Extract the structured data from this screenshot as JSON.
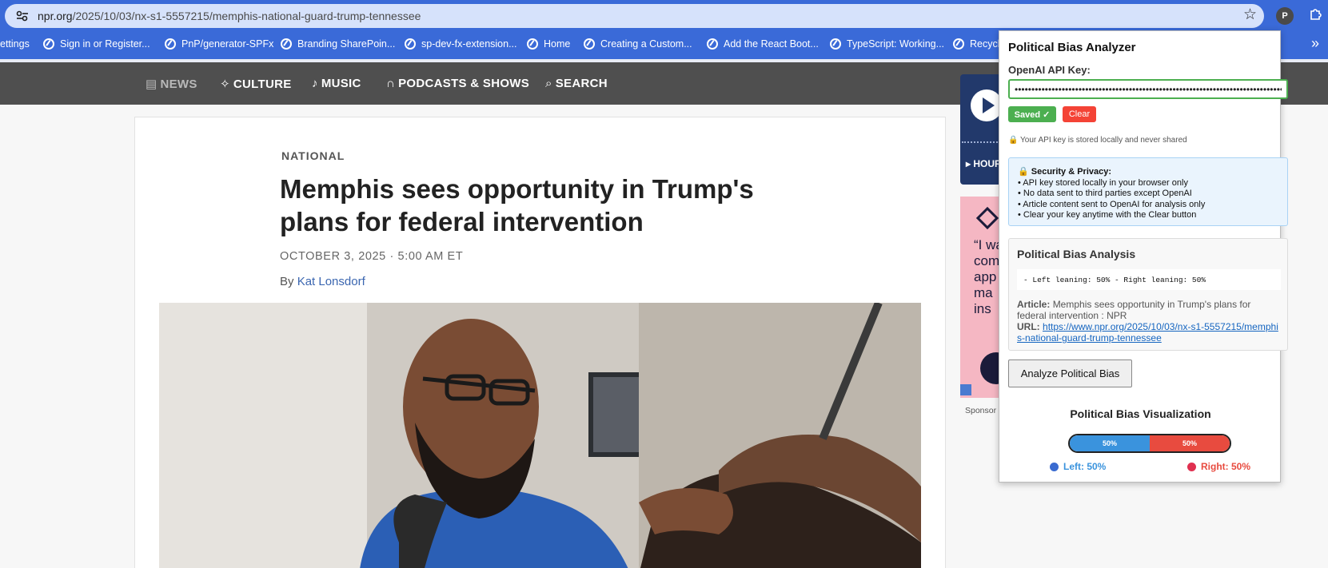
{
  "browser": {
    "url_host": "npr.org",
    "url_path": "/2025/10/03/nx-s1-5557215/memphis-national-guard-trump-tennessee",
    "profile_initial": "P",
    "icons": {
      "site_info": "tune-icon",
      "star": "star-icon",
      "extensions": "puzzle-icon"
    }
  },
  "bookmarks": [
    {
      "label": "ettings"
    },
    {
      "label": "Sign in or Register..."
    },
    {
      "label": "PnP/generator-SPFx"
    },
    {
      "label": "Branding SharePoin..."
    },
    {
      "label": "sp-dev-fx-extension..."
    },
    {
      "label": "Home"
    },
    {
      "label": "Creating a Custom..."
    },
    {
      "label": "Add the React Boot..."
    },
    {
      "label": "TypeScript: Working..."
    },
    {
      "label": "Recycle"
    }
  ],
  "npr_nav": {
    "items": [
      "NEWS",
      "CULTURE",
      "MUSIC",
      "PODCASTS & SHOWS",
      "SEARCH"
    ]
  },
  "article": {
    "section": "NATIONAL",
    "title": "Memphis sees opportunity in Trump's plans for federal intervention",
    "date": "OCTOBER 3, 2025 · 5:00 AM ET",
    "byline_prefix": "By",
    "author": "Kat Lonsdorf"
  },
  "sidebar": {
    "player_label": "▸ HOUR",
    "ad_text": "“I wa\ncom\napp\nma\nins",
    "sponsor_label": "Sponsor"
  },
  "popup": {
    "title": "Political Bias Analyzer",
    "api_key_label": "OpenAI API Key:",
    "api_key_value": "••••••••••••••••••••••••••••••••••••••••••••••••••••••••••••••••••••••••••••••••••••••••••••",
    "saved_label": "Saved ✓",
    "clear_label": "Clear",
    "storage_note": "🔒 Your API key is stored locally and never shared",
    "security": {
      "heading": "🔒 Security & Privacy:",
      "lines": [
        "• API key stored locally in your browser only",
        "• No data sent to third parties except OpenAI",
        "• Article content sent to OpenAI for analysis only",
        "• Clear your key anytime with the Clear button"
      ]
    },
    "analysis": {
      "title": "Political Bias Analysis",
      "result": "- Left leaning: 50% - Right leaning: 50%",
      "article_label": "Article:",
      "article_value": "Memphis sees opportunity in Trump's plans for federal intervention : NPR",
      "url_label": "URL:",
      "url_value": "https://www.npr.org/2025/10/03/nx-s1-5557215/memphis-national-guard-trump-tennessee"
    },
    "analyze_button": "Analyze Political Bias",
    "visualization": {
      "title": "Political Bias Visualization",
      "left_pct": 50,
      "right_pct": 50,
      "left_bar_label": "50%",
      "right_bar_label": "50%",
      "legend_left": "Left: 50%",
      "legend_right": "Right: 50%",
      "left_color": "#3a93dd",
      "right_color": "#e84b3f"
    }
  }
}
